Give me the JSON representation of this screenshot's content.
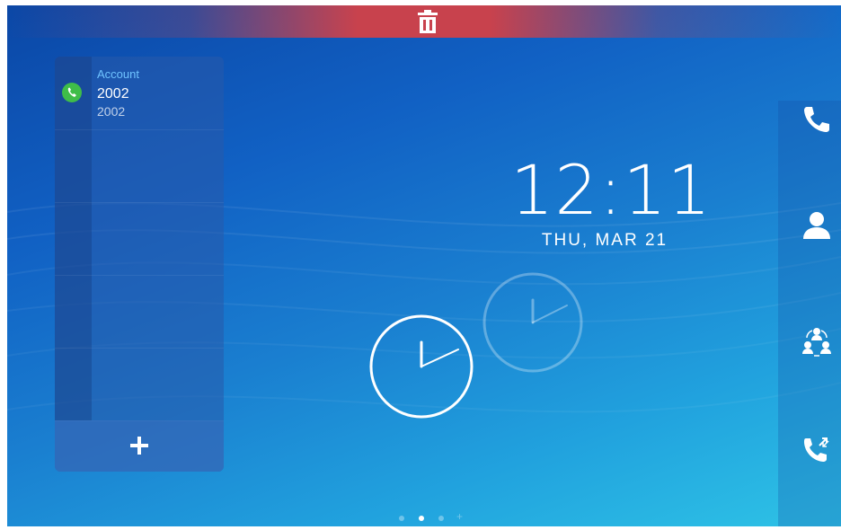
{
  "account_panel": {
    "account_label": "Account",
    "account_number": "2002",
    "account_sub": "2002",
    "add_label": "+"
  },
  "clock": {
    "time": "12:11",
    "date": "THU, MAR 21"
  },
  "sidebar": {
    "items": [
      {
        "icon": "phone-icon"
      },
      {
        "icon": "contact-icon"
      },
      {
        "icon": "conference-icon"
      },
      {
        "icon": "call-transfer-icon"
      }
    ]
  },
  "page_indicator": {
    "count": 4,
    "active_index": 1
  },
  "colors": {
    "trash_bar": "#c8424d",
    "account_label": "#6fc3ff",
    "account_status": "#3fbd49"
  }
}
